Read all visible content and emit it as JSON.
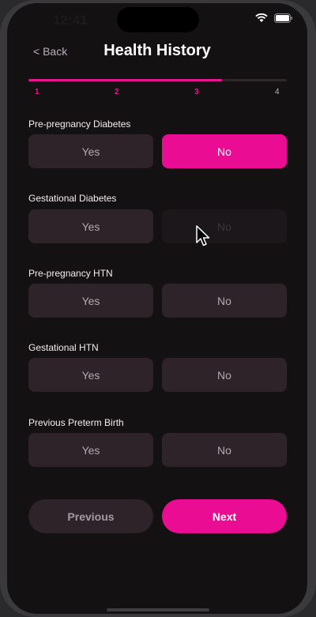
{
  "status_bar": {
    "time": "12:41",
    "icons": [
      "wifi-icon",
      "battery-icon"
    ]
  },
  "header": {
    "back_label": "< Back",
    "title": "Health History"
  },
  "progress": {
    "current_step": 3,
    "total_steps": 4,
    "fill_fraction": 0.75,
    "steps": [
      "1",
      "2",
      "3",
      "4"
    ]
  },
  "questions": [
    {
      "label": "Pre-pregnancy Diabetes",
      "yes": "Yes",
      "no": "No",
      "selected": "No"
    },
    {
      "label": "Gestational Diabetes",
      "yes": "Yes",
      "no": "No",
      "selected": ""
    },
    {
      "label": "Pre-pregnancy HTN",
      "yes": "Yes",
      "no": "No",
      "selected": ""
    },
    {
      "label": "Gestational HTN",
      "yes": "Yes",
      "no": "No",
      "selected": ""
    },
    {
      "label": "Previous Preterm Birth",
      "yes": "Yes",
      "no": "No",
      "selected": ""
    }
  ],
  "navigation": {
    "previous_label": "Previous",
    "next_label": "Next"
  },
  "colors": {
    "accent": "#ea0d94",
    "background": "#141113",
    "button_unselected": "#2e2329"
  }
}
